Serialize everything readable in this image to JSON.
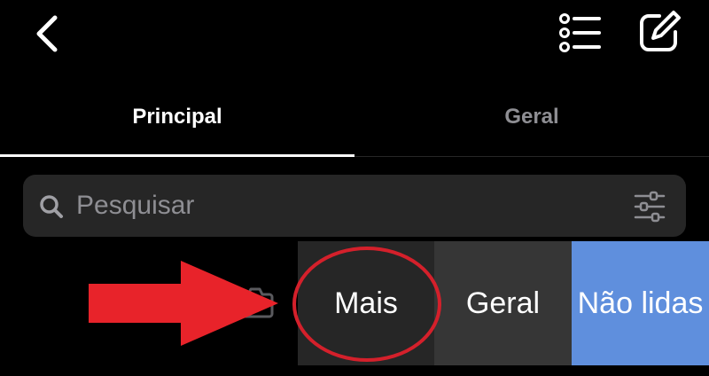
{
  "topbar": {
    "back_icon": "chevron-left-icon",
    "list_icon": "list-icon",
    "compose_icon": "compose-icon"
  },
  "tabs": [
    {
      "label": "Principal",
      "active": true
    },
    {
      "label": "Geral",
      "active": false
    }
  ],
  "search": {
    "placeholder": "Pesquisar",
    "value": "",
    "search_icon": "search-icon",
    "filter_icon": "sliders-icon"
  },
  "row": {
    "camera_icon": "camera-icon"
  },
  "swipe_actions": [
    {
      "label": "Mais",
      "color": "#262626"
    },
    {
      "label": "Geral",
      "color": "#363636"
    },
    {
      "label": "Não lidas",
      "color": "#5f8fdd"
    }
  ],
  "annotation": {
    "arrow_color": "#e8232a",
    "circle_color": "#d4202b"
  },
  "colors": {
    "background": "#000000",
    "search_bg": "#262626",
    "inactive_text": "#8e8e93"
  }
}
